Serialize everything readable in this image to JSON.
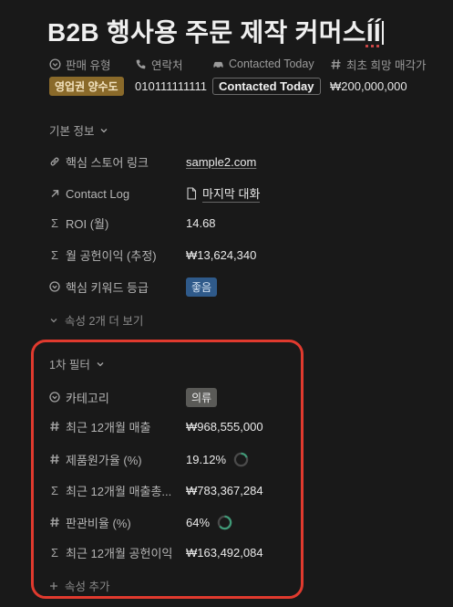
{
  "title": {
    "main": "B2B 행사용 주문 제작 커머스",
    "composing": "ÍÍ"
  },
  "header_props": [
    {
      "label": "판매 유형",
      "icon": "chevron-circle-icon",
      "value": "영업권 양수도"
    },
    {
      "label": "연락처",
      "icon": "phone-icon",
      "value": "010111111111"
    },
    {
      "label": "Contacted Today",
      "icon": "car-icon",
      "value": "Contacted Today"
    },
    {
      "label": "최초 희망 매각가",
      "icon": "hash-icon",
      "value": "₩200,000,000"
    }
  ],
  "basic_section": {
    "toggle_label": "기본 정보",
    "rows": [
      {
        "label": "핵심 스토어 링크",
        "icon": "link-icon",
        "value": "sample2.com"
      },
      {
        "label": "Contact Log",
        "icon": "arrow-up-right-icon",
        "value": "마지막 대화"
      },
      {
        "label": "ROI (월)",
        "icon": "sigma-icon",
        "value": "14.68"
      },
      {
        "label": "월 공헌이익 (추정)",
        "icon": "sigma-icon",
        "value": "₩13,624,340"
      },
      {
        "label": "핵심 키워드 등급",
        "icon": "chevron-circle-icon",
        "value": "좋음"
      }
    ],
    "more_label": "속성 2개 더 보기"
  },
  "filter_section": {
    "toggle_label": "1차 필터",
    "rows": [
      {
        "label": "카테고리",
        "icon": "chevron-circle-icon",
        "value": "의류"
      },
      {
        "label": "최근 12개월 매출",
        "icon": "hash-icon",
        "value": "₩968,555,000"
      },
      {
        "label": "제품원가율 (%)",
        "icon": "hash-icon",
        "value": "19.12%",
        "ring_fraction": 0.1912
      },
      {
        "label": "최근 12개월 매출총...",
        "icon": "sigma-icon",
        "value": "₩783,367,284"
      },
      {
        "label": "판관비율 (%)",
        "icon": "hash-icon",
        "value": "64%",
        "ring_fraction": 0.64
      },
      {
        "label": "최근 12개월 공헌이익",
        "icon": "sigma-icon",
        "value": "₩163,492,084"
      }
    ],
    "add_label": "속성 추가"
  },
  "colors": {
    "highlight_border": "#e03a2e",
    "ring_progress": "#3f9a77",
    "ring_track": "#4a4a4a"
  }
}
